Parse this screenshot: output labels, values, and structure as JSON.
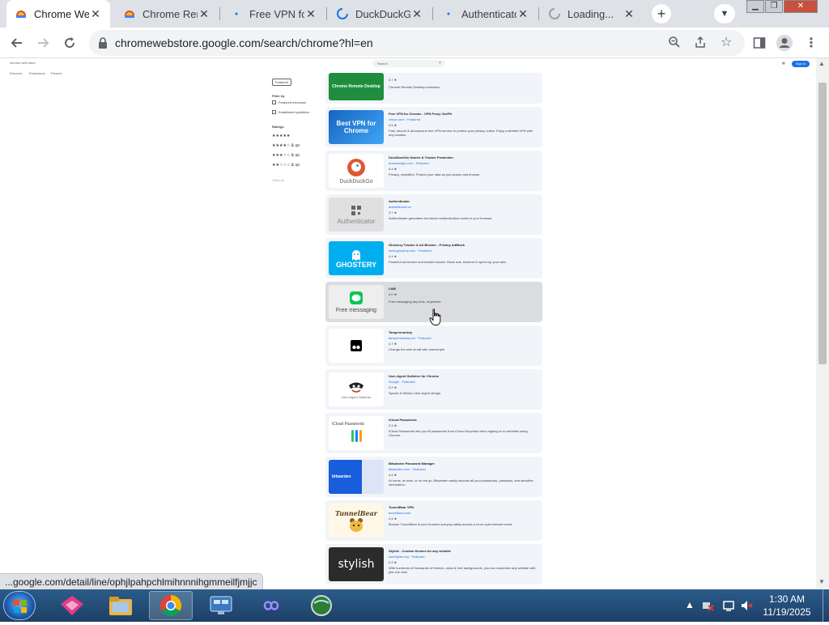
{
  "browser": {
    "tabs": [
      {
        "title": "Chrome Web Store",
        "active": true
      },
      {
        "title": "Chrome Remote Desktop",
        "active": false
      },
      {
        "title": "Free VPN for Chrome",
        "active": false
      },
      {
        "title": "DuckDuckGo Privacy",
        "active": false
      },
      {
        "title": "Authenticator",
        "active": false
      },
      {
        "title": "Loading...",
        "active": false
      }
    ],
    "new_tab_symbol": "+",
    "url": "chromewebstore.google.com/search/chrome?hl=en"
  },
  "store": {
    "header_brand": "chrome web store",
    "nav": [
      "Discover",
      "Extensions",
      "Themes"
    ],
    "search_placeholder": "Search",
    "sign_in": "Sign in",
    "filters": {
      "button": "Featured",
      "group_label": "Filter by",
      "options": [
        "Featured extension",
        "Established publisher"
      ],
      "rating_label": "Ratings",
      "ratings": [
        "★★★★★",
        "★★★★☆ & up",
        "★★★☆☆ & up",
        "★★☆☆☆ & up"
      ],
      "reset": "Clear all"
    },
    "items": [
      {
        "name": "Chrome Remote Desktop",
        "publisher": "",
        "rating": "3.7 ★",
        "desc": "Chrome Remote Desktop extension",
        "thumb_text": "Chrome Remote Desktop"
      },
      {
        "name": "Free VPN for Chrome - VPN Proxy VeePN",
        "publisher": "veepn.com",
        "featured": "Featured",
        "rating": "4.5 ★",
        "desc": "Fast, secure & anonymous free VPN service to protect your privacy online. Enjoy unlimited VPN with any location.",
        "thumb_text": "Best VPN for Chrome"
      },
      {
        "name": "DuckDuckGo Search & Tracker Protection",
        "publisher": "duckduckgo.com",
        "featured": "Featured",
        "rating": "4.4 ★",
        "desc": "Privacy, simplified. Protect your data as you search and browse.",
        "thumb_text": "DuckDuckGo"
      },
      {
        "name": "Authenticator",
        "publisher": "authenticator.cc",
        "rating": "3.7 ★",
        "desc": "Authenticator generates two-factor authentication codes in your browser.",
        "thumb_text": "Authenticator"
      },
      {
        "name": "Ghostery Tracker & Ad Blocker - Privacy AdBlock",
        "publisher": "www.ghostery.com",
        "featured": "Featured",
        "rating": "4.4 ★",
        "desc": "Powerful ad blocker and tracker blocker. Block ads, trackers & speed up your web.",
        "thumb_text": "GHOSTERY"
      },
      {
        "name": "LINE",
        "publisher": "",
        "rating": "4.0 ★",
        "desc": "Free messaging any time, anywhere.",
        "thumb_text": "Free messaging"
      },
      {
        "name": "Tampermonkey",
        "publisher": "tampermonkey.net",
        "featured": "Featured",
        "rating": "4.7 ★",
        "desc": "Change the web at will with userscripts",
        "thumb_text": ""
      },
      {
        "name": "User-Agent Switcher for Chrome",
        "publisher": "Google",
        "featured": "Featured",
        "rating": "3.9 ★",
        "desc": "Spoofs & Mimics User-Agent strings.",
        "thumb_text": "User-Agent Switcher"
      },
      {
        "name": "iCloud Passwords",
        "publisher": "",
        "rating": "3.3 ★",
        "desc": "iCloud Passwords lets you fill passwords from iCloud Keychain when signing in to websites using Chrome.",
        "thumb_text": "iCloud Passwords"
      },
      {
        "name": "Bitwarden Password Manager",
        "publisher": "bitwarden.com",
        "featured": "Featured",
        "rating": "4.6 ★",
        "desc": "At home, at work, or on the go, Bitwarden easily secures all your passwords, passkeys, and sensitive information.",
        "thumb_text": "bitwarden"
      },
      {
        "name": "TunnelBear VPN",
        "publisher": "tunnelbear.com",
        "rating": "4.4 ★",
        "desc": "Browse TunnelBear is your browser and pay safely access a more open internet world.",
        "thumb_text": "TunnelBear"
      },
      {
        "name": "Stylish - Custom themes for any website",
        "publisher": "userstyles.org",
        "featured": "Featured",
        "rating": "4.3 ★",
        "desc": "With hundreds of thousands of themes, skins & free backgrounds, you can customize any website with just one click.",
        "thumb_text": "stylish"
      }
    ]
  },
  "status_url": "...google.com/detail/line/ophjlpahpchlmihnnnihgmmeilfjmjjc",
  "taskbar": {
    "time": "1:30 AM",
    "date": "11/19/2025"
  },
  "colors": {
    "tab_strip": "#dee1e6",
    "card": "#f1f4f8",
    "card_hover": "#dadcdf",
    "link": "#1a73e8",
    "taskbar": "#1d3f66"
  }
}
